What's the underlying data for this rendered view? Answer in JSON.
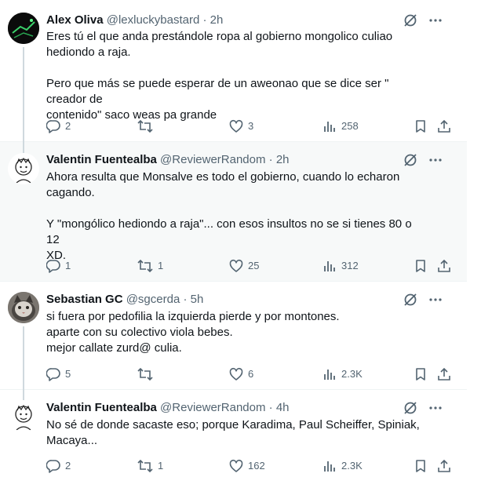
{
  "tweets": [
    {
      "name": "Alex Oliva",
      "handle": "@lexluckybastard",
      "time": "· 2h",
      "lines": [
        "Eres tú el que anda prestándole ropa al gobierno mongolico culiao",
        "hediondo  a raja.",
        "",
        "Pero que más se puede esperar de un aweonao que se dice ser \" creador de",
        "contenido\" saco weas pa grande"
      ],
      "replies": "2",
      "retweets": "",
      "likes": "3",
      "views": "258"
    },
    {
      "name": "Valentin Fuentealba",
      "handle": "@ReviewerRandom",
      "time": "· 2h",
      "lines": [
        "Ahora resulta que Monsalve es todo el gobierno, cuando lo echaron",
        "cagando.",
        "",
        "Y \"mongólico hediondo a raja\"... con esos insultos no se si tienes 80 o 12",
        "XD."
      ],
      "replies": "1",
      "retweets": "1",
      "likes": "25",
      "views": "312"
    },
    {
      "name": "Sebastian GC",
      "handle": "@sgcerda",
      "time": "· 5h",
      "lines": [
        "si fuera por pedofilia la izquierda pierde y por montones.",
        "aparte con su colectivo viola bebes.",
        "mejor callate zurd@ culia."
      ],
      "replies": "5",
      "retweets": "",
      "likes": "6",
      "views": "2.3K"
    },
    {
      "name": "Valentin Fuentealba",
      "handle": "@ReviewerRandom",
      "time": "· 4h",
      "lines": [
        "No sé de donde sacaste eso; porque Karadima, Paul Scheiffer, Spiniak,",
        "Macaya..."
      ],
      "replies": "2",
      "retweets": "1",
      "likes": "162",
      "views": "2.3K"
    }
  ],
  "icons": {
    "reply": "reply-icon",
    "retweet": "retweet-icon",
    "like": "heart-icon",
    "views": "views-icon",
    "bookmark": "bookmark-icon",
    "share": "share-icon",
    "grok": "grok-icon",
    "more": "more-icon"
  },
  "colors": {
    "text": "#0f1419",
    "muted": "#536471",
    "highlight_bg": "#f7f9f9",
    "thread_line": "#cfd9de"
  }
}
